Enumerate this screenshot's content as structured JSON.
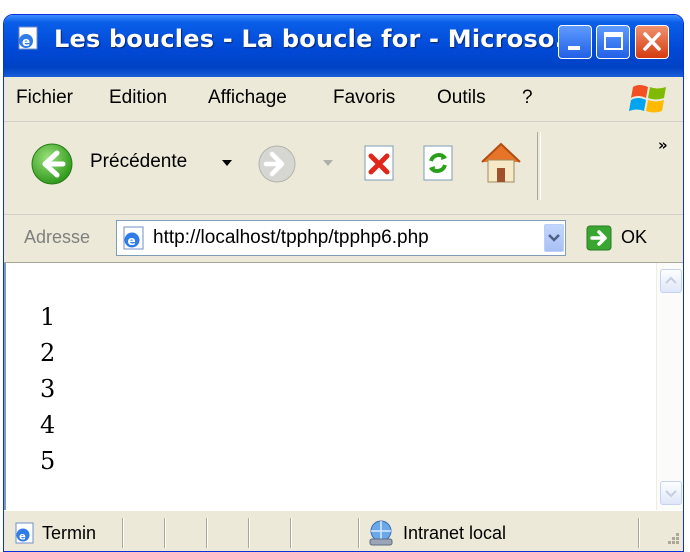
{
  "window": {
    "title": "Les boucles - La boucle for - Microso...",
    "controls": [
      "minimize",
      "maximize",
      "close"
    ]
  },
  "menubar": {
    "items": [
      "Fichier",
      "Edition",
      "Affichage",
      "Favoris",
      "Outils",
      "?"
    ]
  },
  "toolbar": {
    "back_label": "Précédente",
    "more_label": "»",
    "icons": [
      "back-icon",
      "forward-icon",
      "stop-icon",
      "refresh-icon",
      "home-icon"
    ]
  },
  "addressbar": {
    "label": "Adresse",
    "url": "http://localhost/tpphp/tpphp6.php",
    "go_label": "OK"
  },
  "content": {
    "lines": [
      "1",
      "2",
      "3",
      "4",
      "5"
    ]
  },
  "statusbar": {
    "status_text": "Termin",
    "zone_label": "Intranet local"
  },
  "colors": {
    "titlebar": "#0049d6",
    "chrome": "#ece9d8",
    "close_button": "#d53a10",
    "back_arrow": "#3fae24"
  }
}
